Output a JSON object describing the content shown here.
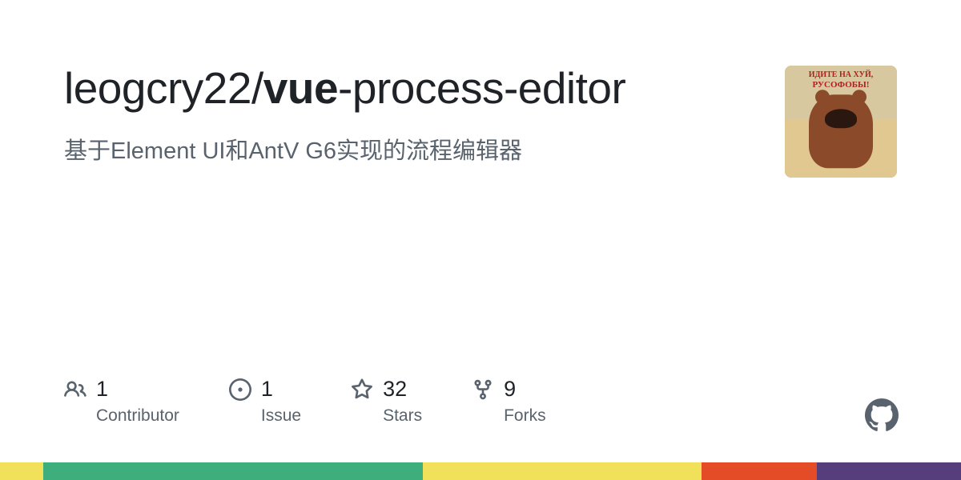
{
  "owner": "leogcry22",
  "slash": "/",
  "repo_parts": {
    "bold": "vue",
    "rest": "-process-editor"
  },
  "description": "基于Element UI和AntV G6实现的流程编辑器",
  "avatar": {
    "line1": "ИДИТЕ НА ХУЙ,",
    "line2": "РУСОФОБЫ!"
  },
  "stats": [
    {
      "icon": "people",
      "count": "1",
      "label": "Contributor"
    },
    {
      "icon": "issue",
      "count": "1",
      "label": "Issue"
    },
    {
      "icon": "star",
      "count": "32",
      "label": "Stars"
    },
    {
      "icon": "fork",
      "count": "9",
      "label": "Forks"
    }
  ],
  "color_bar": [
    {
      "color": "#f1e05a",
      "width": "4.5%"
    },
    {
      "color": "#3eaf7c",
      "width": "39.5%"
    },
    {
      "color": "#f1e05a",
      "width": "29%"
    },
    {
      "color": "#e34c26",
      "width": "12%"
    },
    {
      "color": "#563d7c",
      "width": "15%"
    }
  ]
}
